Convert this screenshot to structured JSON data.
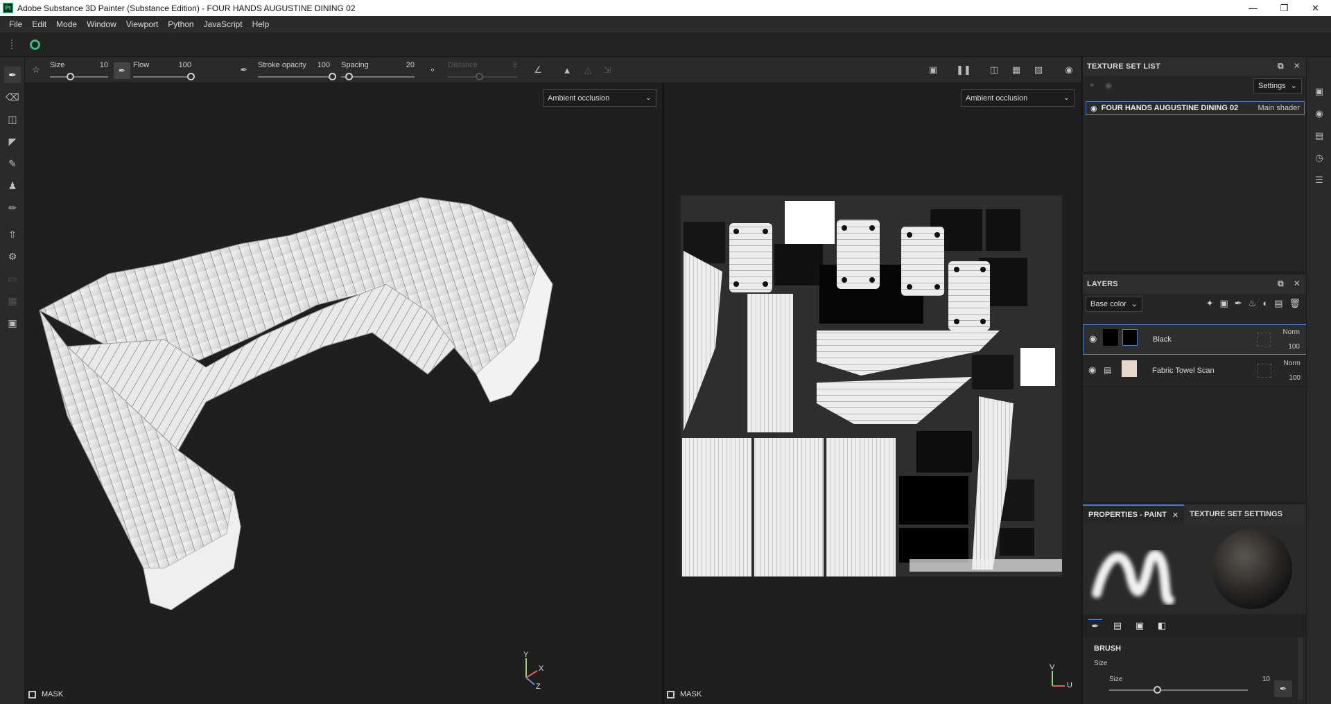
{
  "window": {
    "app_icon": "Pt",
    "title": "Adobe Substance 3D Painter (Substance Edition) - FOUR HANDS AUGUSTINE DINING 02",
    "controls": [
      "minimize-icon",
      "restore-icon",
      "close-icon"
    ]
  },
  "menu": [
    "File",
    "Edit",
    "Mode",
    "Window",
    "Viewport",
    "Python",
    "JavaScript",
    "Help"
  ],
  "tool_properties": {
    "size": {
      "label": "Size",
      "value": "10"
    },
    "flow": {
      "label": "Flow",
      "value": "100"
    },
    "stroke_opacity": {
      "label": "Stroke opacity",
      "value": "100"
    },
    "spacing": {
      "label": "Spacing",
      "value": "20"
    },
    "distance": {
      "label": "Distance",
      "value": "8"
    }
  },
  "viewport_3d": {
    "channel_select": "Ambient occlusion",
    "mask_label": "MASK",
    "gizmo": {
      "y": "Y",
      "x": "X",
      "z": "Z"
    }
  },
  "viewport_2d": {
    "channel_select": "Ambient occlusion",
    "mask_label": "MASK",
    "gizmo": {
      "v": "V",
      "u": "U"
    }
  },
  "texture_set_list": {
    "title": "TEXTURE SET LIST",
    "settings_label": "Settings",
    "items": [
      {
        "name": "FOUR HANDS AUGUSTINE DINING 02",
        "shader": "Main shader"
      }
    ]
  },
  "layers": {
    "title": "LAYERS",
    "channel": "Base color",
    "items": [
      {
        "name": "Black",
        "blend": "Norm",
        "opacity": "100"
      },
      {
        "name": "Fabric Towel Scan",
        "blend": "Norm",
        "opacity": "100"
      }
    ]
  },
  "properties": {
    "tab_paint": "PROPERTIES - PAINT",
    "tab_texture_set": "TEXTURE SET SETTINGS",
    "brush_title": "BRUSH",
    "size_group": "Size",
    "size_label": "Size",
    "size_value": "10"
  }
}
